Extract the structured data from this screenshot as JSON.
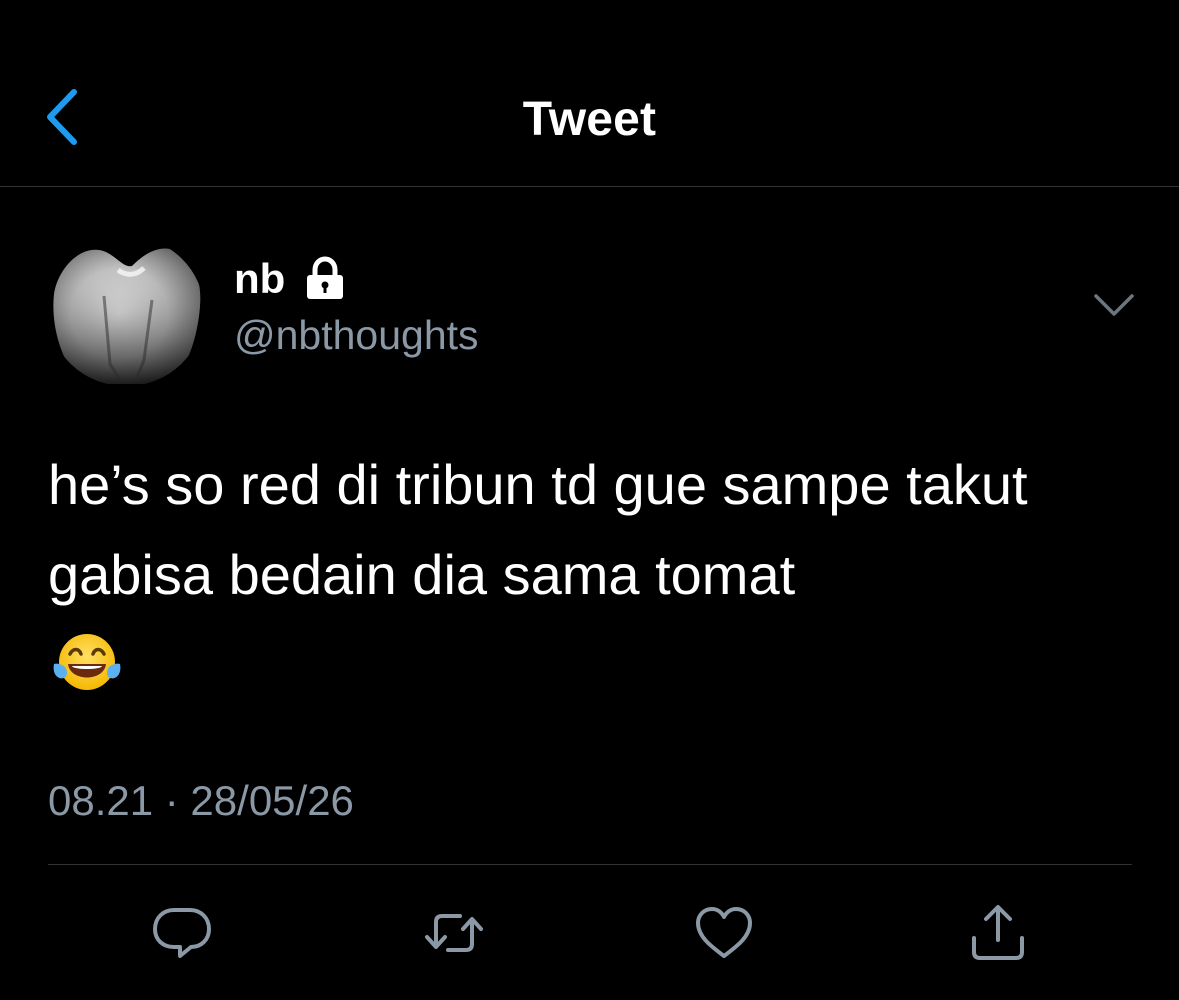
{
  "header": {
    "title": "Tweet",
    "back_icon": "chevron-left-icon",
    "accent": "#1d9bf0"
  },
  "tweet": {
    "display_name": "nb",
    "protected_icon": "lock-icon",
    "handle": "@nbthoughts",
    "more_icon": "chevron-down-icon",
    "text": "he’s so red di tribun td gue sampe takut gabisa bedain dia sama tomat",
    "emoji": "face-with-tears-of-joy-emoji",
    "timestamp": "08.21 · 28/05/26"
  },
  "actions": {
    "reply_icon": "reply-icon",
    "retweet_icon": "retweet-icon",
    "like_icon": "heart-icon",
    "share_icon": "share-icon"
  },
  "colors": {
    "background": "#000000",
    "text": "#ffffff",
    "secondary_text": "#8b98a5",
    "divider": "#2f3336"
  }
}
